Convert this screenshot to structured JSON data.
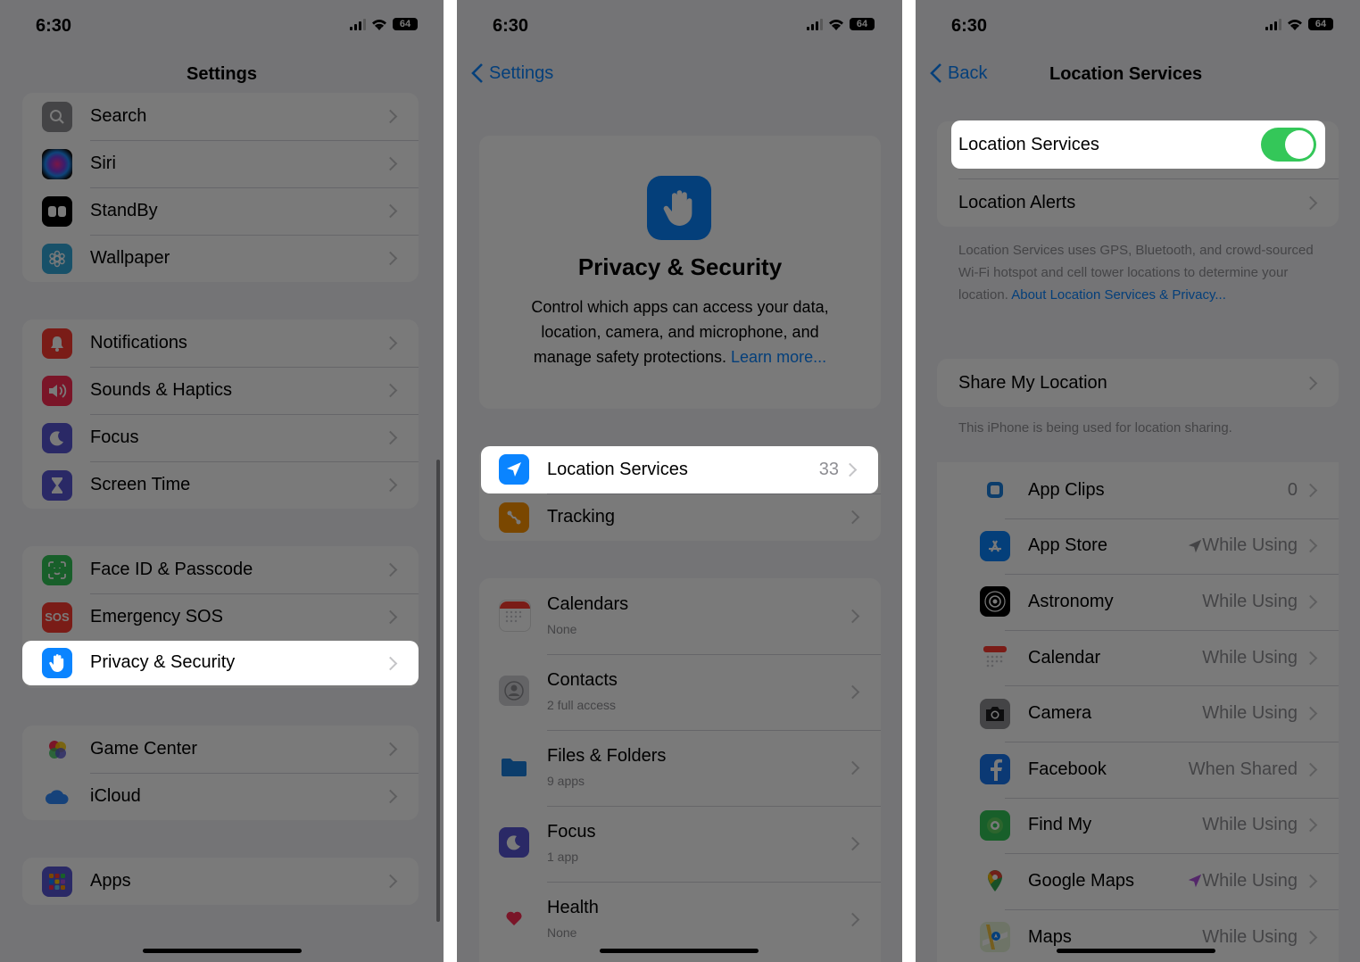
{
  "status": {
    "time": "6:30",
    "battery": "64"
  },
  "p1": {
    "title": "Settings",
    "rows": [
      {
        "label": "Search",
        "icon": "search-icon",
        "color": "#8e8e93"
      },
      {
        "label": "Siri",
        "icon": "siri-icon",
        "color": "#1c1c1e"
      },
      {
        "label": "StandBy",
        "icon": "standby-icon",
        "color": "#000000"
      },
      {
        "label": "Wallpaper",
        "icon": "wallpaper-icon",
        "color": "#34aadc"
      },
      {
        "label": "Notifications",
        "icon": "bell-icon",
        "color": "#ff3b30"
      },
      {
        "label": "Sounds & Haptics",
        "icon": "speaker-icon",
        "color": "#ff2d55"
      },
      {
        "label": "Focus",
        "icon": "moon-icon",
        "color": "#5856d6"
      },
      {
        "label": "Screen Time",
        "icon": "hourglass-icon",
        "color": "#5856d6"
      },
      {
        "label": "Face ID & Passcode",
        "icon": "face-id-icon",
        "color": "#34c759"
      },
      {
        "label": "Emergency SOS",
        "icon": "sos-icon",
        "sos_text": "SOS",
        "color": "#ff3b30"
      },
      {
        "label": "Privacy & Security",
        "icon": "hand-icon",
        "color": "#0a84ff"
      },
      {
        "label": "Game Center",
        "icon": "game-center-icon",
        "color": "#ffffff"
      },
      {
        "label": "iCloud",
        "icon": "icloud-icon",
        "color": "#ffffff"
      },
      {
        "label": "Apps",
        "icon": "apps-grid-icon",
        "color": "#5856d6"
      }
    ]
  },
  "p2": {
    "back_label": "Settings",
    "header_title": "Privacy & Security",
    "header_desc": "Control which apps can access your data, location, camera, and microphone, and manage safety protections.",
    "learn_more": "Learn more...",
    "location": {
      "label": "Location Services",
      "value": "33"
    },
    "tracking": {
      "label": "Tracking"
    },
    "items": [
      {
        "label": "Calendars",
        "sub": "None",
        "icon": "calendar-icon"
      },
      {
        "label": "Contacts",
        "sub": "2 full access",
        "icon": "contacts-icon"
      },
      {
        "label": "Files & Folders",
        "sub": "9 apps",
        "icon": "folder-icon"
      },
      {
        "label": "Focus",
        "sub": "1 app",
        "icon": "moon-icon"
      },
      {
        "label": "Health",
        "sub": "None",
        "icon": "heart-icon"
      }
    ]
  },
  "p3": {
    "back_label": "Back",
    "title": "Location Services",
    "toggle_label": "Location Services",
    "alerts_label": "Location Alerts",
    "footnote": "Location Services uses GPS, Bluetooth, and crowd-sourced Wi-Fi hotspot and cell tower locations to determine your location.",
    "footnote_link": "About Location Services & Privacy...",
    "share_label": "Share My Location",
    "share_note": "This iPhone is being used for location sharing.",
    "apps": [
      {
        "name": "App Clips",
        "value": "0",
        "icon": "app-clips-icon",
        "arrow": false
      },
      {
        "name": "App Store",
        "value": "While Using",
        "icon": "app-store-icon",
        "arrow": true,
        "arrow_color": "#8e8e93"
      },
      {
        "name": "Astronomy",
        "value": "While Using",
        "icon": "astronomy-icon",
        "arrow": false
      },
      {
        "name": "Calendar",
        "value": "While Using",
        "icon": "calendar-icon",
        "arrow": false
      },
      {
        "name": "Camera",
        "value": "While Using",
        "icon": "camera-icon",
        "arrow": false
      },
      {
        "name": "Facebook",
        "value": "When Shared",
        "icon": "facebook-icon",
        "arrow": false
      },
      {
        "name": "Find My",
        "value": "While Using",
        "icon": "find-my-icon",
        "arrow": false
      },
      {
        "name": "Google Maps",
        "value": "While Using",
        "icon": "google-maps-icon",
        "arrow": true,
        "arrow_color": "#af52de"
      },
      {
        "name": "Maps",
        "value": "While Using",
        "icon": "maps-icon",
        "arrow": false
      }
    ]
  }
}
